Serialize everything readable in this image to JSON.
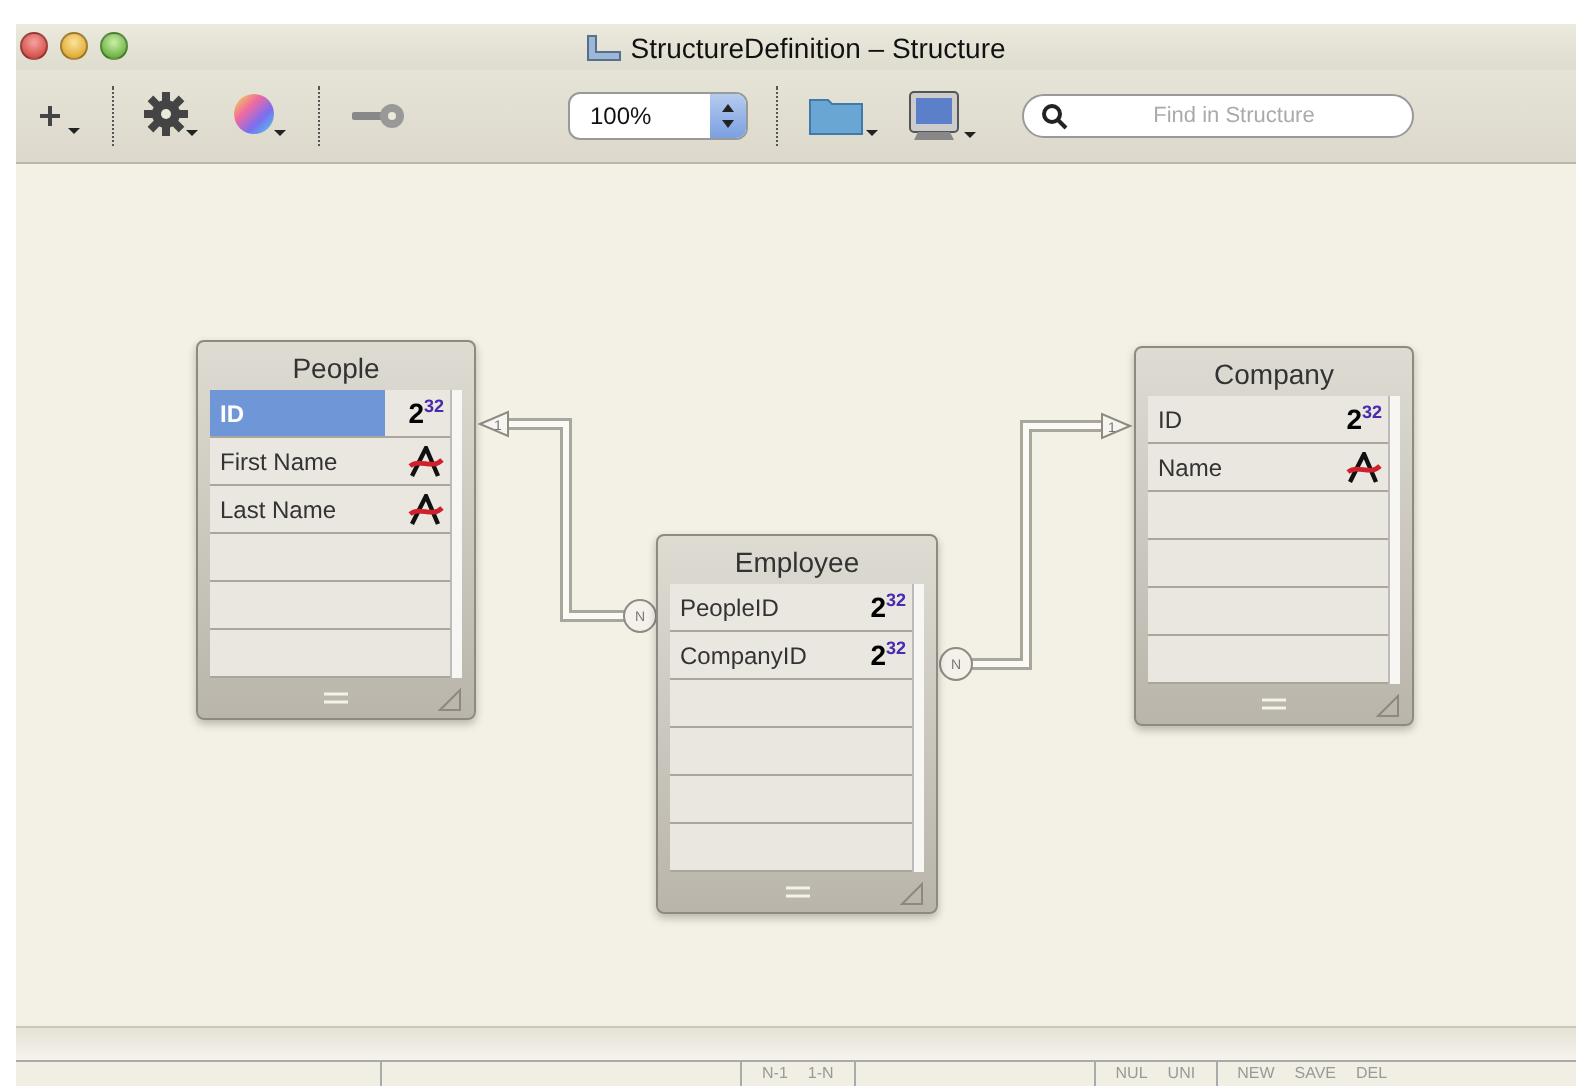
{
  "window": {
    "title": "StructureDefinition – Structure"
  },
  "toolbar": {
    "zoom": "100%",
    "search": {
      "placeholder": "Find in Structure"
    }
  },
  "tables": [
    {
      "name": "People",
      "fields": [
        {
          "name": "ID",
          "kind": "integer",
          "type_label": "2$^{32}$",
          "selected": true
        },
        {
          "name": "First Name",
          "kind": "text",
          "selected": false
        },
        {
          "name": "Last Name",
          "kind": "text",
          "selected": false
        }
      ]
    },
    {
      "name": "Employee",
      "fields": [
        {
          "name": "PeopleID",
          "kind": "integer",
          "type_label": "2$^{32}$",
          "selected": false
        },
        {
          "name": "CompanyID",
          "kind": "integer",
          "type_label": "2$^{32}$",
          "selected": false
        }
      ]
    },
    {
      "name": "Company",
      "fields": [
        {
          "name": "ID",
          "kind": "integer",
          "type_label": "2$^{32}$",
          "selected": false
        },
        {
          "name": "Name",
          "kind": "text",
          "selected": false
        }
      ]
    }
  ],
  "relationships": [
    {
      "one_label": "1",
      "many_label": "N"
    },
    {
      "one_label": "1",
      "many_label": "N"
    }
  ],
  "status_bar": {
    "items": [
      "N-1",
      "1-N",
      "NUL",
      "UNI",
      "NEW",
      "SAVE",
      "DEL"
    ]
  }
}
